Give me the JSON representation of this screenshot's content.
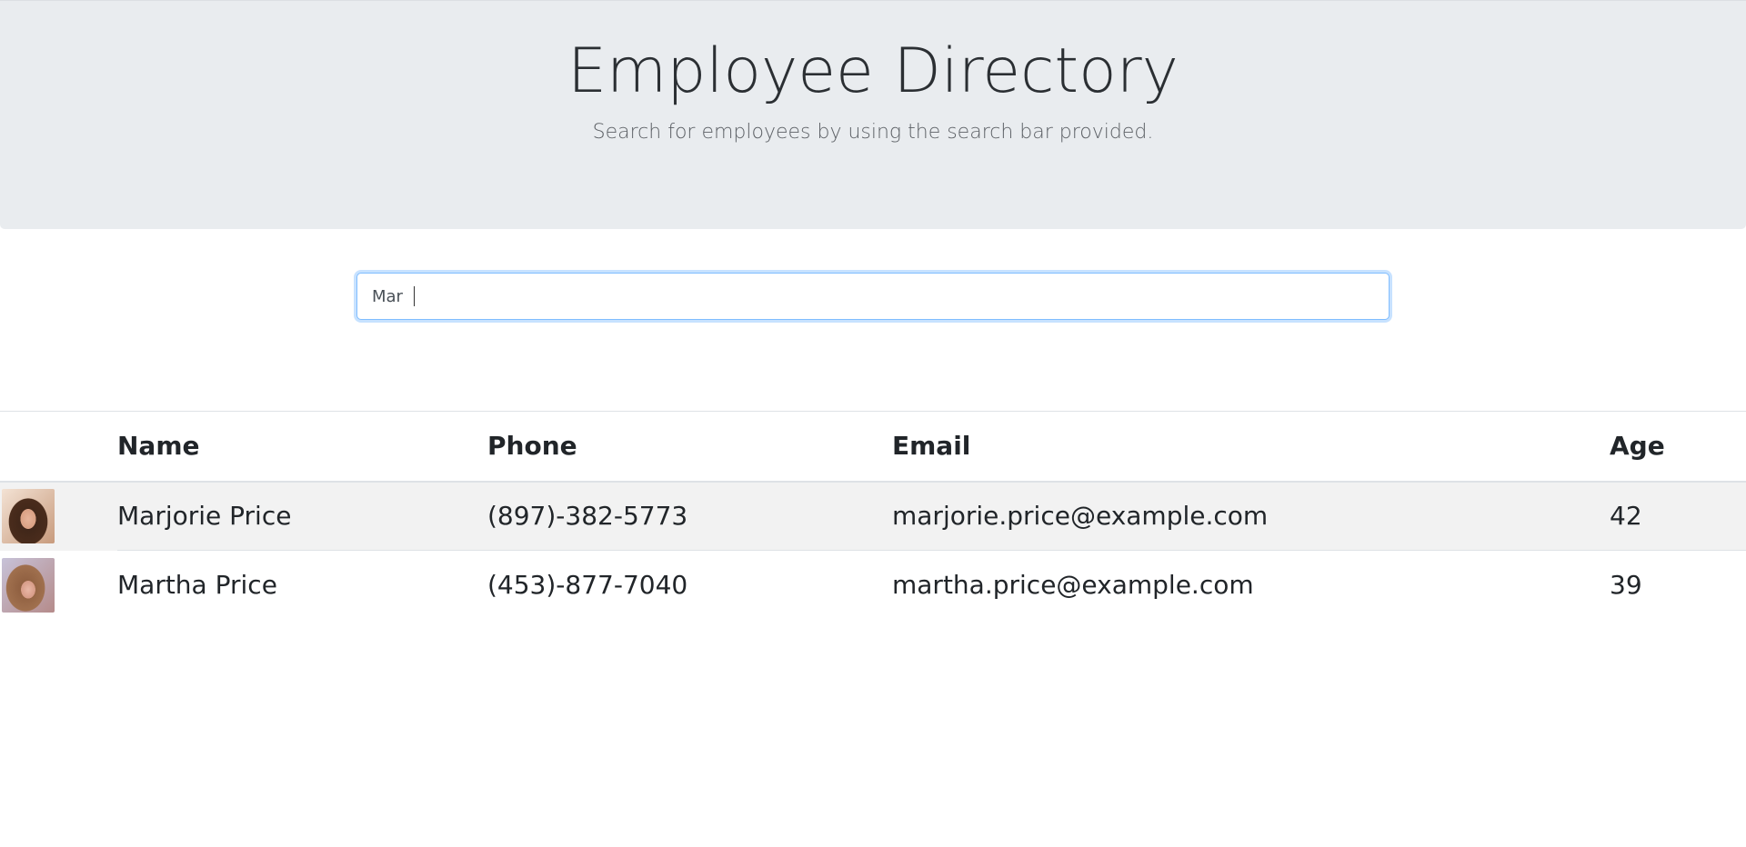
{
  "header": {
    "title": "Employee Directory",
    "subtitle": "Search for employees by using the search bar provided."
  },
  "search": {
    "value": "Mar",
    "placeholder": ""
  },
  "table": {
    "columns": [
      "",
      "Name",
      "Phone",
      "Email",
      "Age"
    ],
    "rows": [
      {
        "avatar": "employee-photo-icon",
        "name": "Marjorie Price",
        "phone": "(897)-382-5773",
        "email": "marjorie.price@example.com",
        "age": "42"
      },
      {
        "avatar": "employee-photo-icon",
        "name": "Martha Price",
        "phone": "(453)-877-7040",
        "email": "martha.price@example.com",
        "age": "39"
      }
    ]
  },
  "colors": {
    "header_bg": "#e9ecef",
    "focus_border": "#80bdff",
    "stripe": "#f2f2f2"
  }
}
